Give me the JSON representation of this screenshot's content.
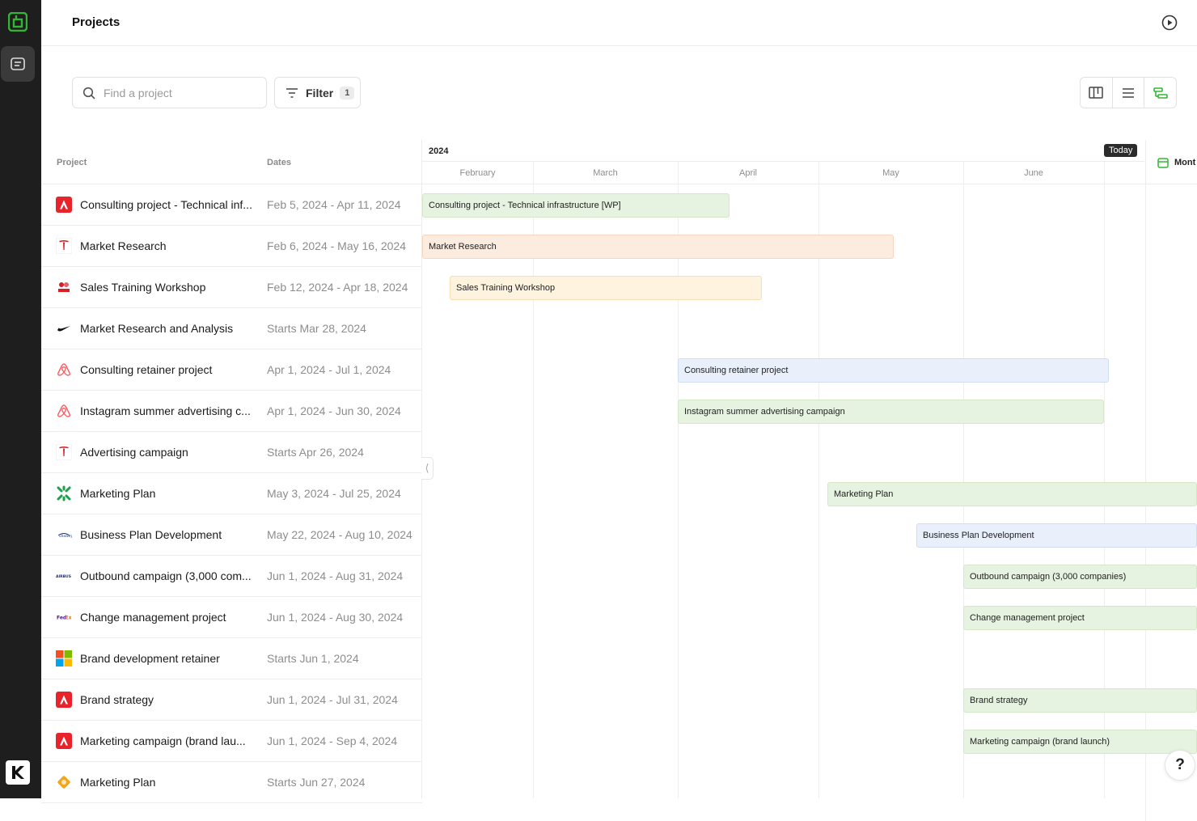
{
  "header": {
    "title": "Projects"
  },
  "search": {
    "placeholder": "Find a project",
    "value": ""
  },
  "filter": {
    "label": "Filter",
    "count": "1"
  },
  "table": {
    "col_project": "Project",
    "col_dates": "Dates"
  },
  "timeline": {
    "year": "2024",
    "today_label": "Today",
    "view_label": "Mont",
    "months": [
      "February",
      "March",
      "April",
      "May",
      "June"
    ]
  },
  "colors": {
    "brand_green": "#35b535",
    "bar_green": "#e6f3e0",
    "bar_peach": "#fcebdf",
    "bar_yellow": "#fef3df",
    "bar_blue": "#e9f0fc"
  },
  "projects": [
    {
      "name": "Consulting project - Technical inf...",
      "dates": "Feb 5, 2024 - Apr 11, 2024",
      "icon": "adobe-icon",
      "bar": "Consulting project - Technical infrastructure [WP]"
    },
    {
      "name": "Market Research",
      "dates": "Feb 6, 2024 - May 16, 2024",
      "icon": "tesla-icon",
      "bar": "Market Research"
    },
    {
      "name": "Sales Training Workshop",
      "dates": "Feb 12, 2024 - Apr 18, 2024",
      "icon": "nevok-icon",
      "bar": "Sales Training Workshop"
    },
    {
      "name": "Market Research and Analysis",
      "dates": "Starts Mar 28, 2024",
      "icon": "nike-icon",
      "bar": ""
    },
    {
      "name": "Consulting retainer project",
      "dates": "Apr 1, 2024 - Jul 1, 2024",
      "icon": "airbnb-icon",
      "bar": "Consulting retainer project"
    },
    {
      "name": "Instagram summer advertising c...",
      "dates": "Apr 1, 2024 - Jun 30, 2024",
      "icon": "airbnb-icon",
      "bar": "Instagram summer advertising campaign"
    },
    {
      "name": "Advertising campaign",
      "dates": "Starts Apr 26, 2024",
      "icon": "tesla-icon",
      "bar": ""
    },
    {
      "name": "Marketing Plan",
      "dates": "May 3, 2024 - Jul 25, 2024",
      "icon": "snowflake-icon",
      "bar": "Marketing Plan"
    },
    {
      "name": "Business Plan Development",
      "dates": "May 22, 2024 - Aug 10, 2024",
      "icon": "disney-icon",
      "bar": "Business Plan Development"
    },
    {
      "name": "Outbound campaign (3,000 com...",
      "dates": "Jun 1, 2024 - Aug 31, 2024",
      "icon": "airbus-icon",
      "bar": "Outbound campaign (3,000 companies)"
    },
    {
      "name": "Change management project",
      "dates": "Jun 1, 2024 - Aug 30, 2024",
      "icon": "fedex-icon",
      "bar": "Change management project"
    },
    {
      "name": "Brand development retainer",
      "dates": "Starts Jun 1, 2024",
      "icon": "microsoft-icon",
      "bar": ""
    },
    {
      "name": "Brand strategy",
      "dates": "Jun 1, 2024 - Jul 31, 2024",
      "icon": "adobe-icon",
      "bar": "Brand strategy"
    },
    {
      "name": "Marketing campaign (brand lau...",
      "dates": "Jun 1, 2024 - Sep 4, 2024",
      "icon": "adobe-icon",
      "bar": "Marketing campaign (brand launch)"
    },
    {
      "name": "Marketing Plan",
      "dates": "Starts Jun 27, 2024",
      "icon": "diamond-icon",
      "bar": ""
    }
  ]
}
